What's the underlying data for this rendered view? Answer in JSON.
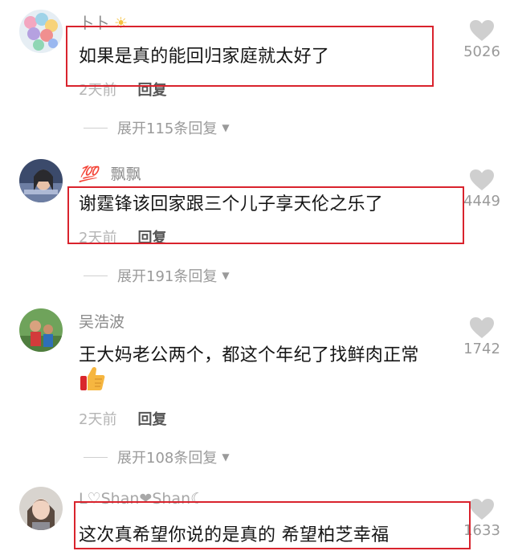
{
  "accent_color": "#d9232d",
  "comments": [
    {
      "username": "卜卜",
      "username_suffix_icon": "sun-icon",
      "text": "如果是真的能回归家庭就太好了",
      "time": "2天前",
      "reply_label": "回复",
      "likes": "5026",
      "expand_label": "展开115条回复"
    },
    {
      "username_prefix": "💯",
      "username": "飘飘",
      "text": "谢霆锋该回家跟三个儿子享天伦之乐了",
      "time": "2天前",
      "reply_label": "回复",
      "likes": "4449",
      "expand_label": "展开191条回复"
    },
    {
      "username": "吴浩波",
      "text": "王大妈老公两个，都这个年纪了找鲜肉正常",
      "emoji": "thumbs-up-icon",
      "time": "2天前",
      "reply_label": "回复",
      "likes": "1742",
      "expand_label": "展开108条回复"
    },
    {
      "username": "L♡Shan❤Shan☾",
      "text": "这次真希望你说的是真的 希望柏芝幸福",
      "likes": "1633"
    }
  ]
}
